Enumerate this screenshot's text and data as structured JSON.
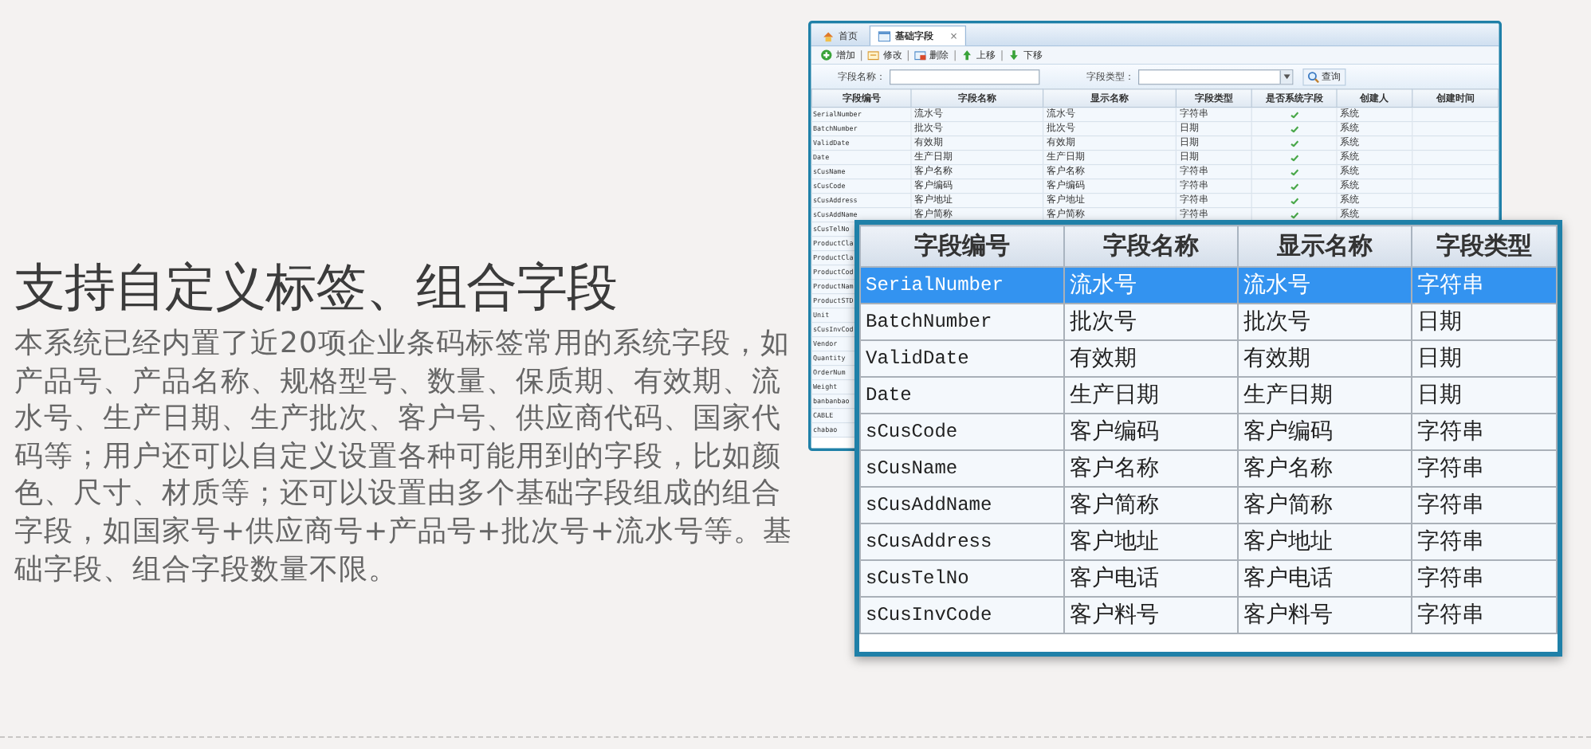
{
  "headline": "支持自定义标签、组合字段",
  "description": "本系统已经内置了近20项企业条码标签常用的系统字段，如产品号、产品名称、规格型号、数量、保质期、有效期、流水号、生产日期、生产批次、客户号、供应商代码、国家代码等；用户还可以自定义设置各种可能用到的字段，比如颜色、尺寸、材质等；还可以设置由多个基础字段组成的组合字段，如国家号+供应商号+产品号+批次号+流水号等。基础字段、组合字段数量不限。",
  "back_window": {
    "tabs": [
      {
        "label": "首页",
        "kind": "home",
        "selected": false
      },
      {
        "label": "基础字段",
        "kind": "page",
        "selected": true,
        "close": "×"
      }
    ],
    "toolbar": [
      {
        "label": "增加",
        "kind": "add"
      },
      {
        "label": "修改",
        "kind": "edit"
      },
      {
        "label": "删除",
        "kind": "delete"
      },
      {
        "label": "上移",
        "kind": "up"
      },
      {
        "label": "下移",
        "kind": "down"
      }
    ],
    "search": {
      "name_label": "字段名称：",
      "type_label": "字段类型：",
      "button": "查询"
    },
    "table": {
      "columns": [
        "字段编号",
        "字段名称",
        "显示名称",
        "字段类型",
        "是否系统字段",
        "创建人",
        "创建时间"
      ],
      "rows": [
        {
          "cells": [
            "SerialNumber",
            "流水号",
            "流水号",
            "字符串",
            "",
            "系统",
            ""
          ],
          "system": true
        },
        {
          "cells": [
            "BatchNumber",
            "批次号",
            "批次号",
            "日期",
            "",
            "系统",
            ""
          ],
          "system": true
        },
        {
          "cells": [
            "ValidDate",
            "有效期",
            "有效期",
            "日期",
            "",
            "系统",
            ""
          ],
          "system": true
        },
        {
          "cells": [
            "Date",
            "生产日期",
            "生产日期",
            "日期",
            "",
            "系统",
            ""
          ],
          "system": true
        },
        {
          "cells": [
            "sCusName",
            "客户名称",
            "客户名称",
            "字符串",
            "",
            "系统",
            ""
          ],
          "system": true
        },
        {
          "cells": [
            "sCusCode",
            "客户编码",
            "客户编码",
            "字符串",
            "",
            "系统",
            ""
          ],
          "system": true
        },
        {
          "cells": [
            "sCusAddress",
            "客户地址",
            "客户地址",
            "字符串",
            "",
            "系统",
            ""
          ],
          "system": true
        },
        {
          "cells": [
            "sCusAddName",
            "客户简称",
            "客户简称",
            "字符串",
            "",
            "系统",
            ""
          ],
          "system": true
        },
        {
          "cells": [
            "sCusTelNo"
          ]
        },
        {
          "cells": [
            "ProductCla"
          ]
        },
        {
          "cells": [
            "ProductCla"
          ]
        },
        {
          "cells": [
            "ProductCod"
          ]
        },
        {
          "cells": [
            "ProductNam"
          ]
        },
        {
          "cells": [
            "ProductSTD"
          ]
        },
        {
          "cells": [
            "Unit"
          ]
        },
        {
          "cells": [
            "sCusInvCod"
          ]
        },
        {
          "cells": [
            "Vendor"
          ]
        },
        {
          "cells": [
            "Quantity"
          ]
        },
        {
          "cells": [
            "OrderNum"
          ]
        },
        {
          "cells": [
            "Weight"
          ]
        },
        {
          "cells": [
            "banbanbao"
          ]
        },
        {
          "cells": [
            "CABLE"
          ]
        },
        {
          "cells": [
            "chabao"
          ]
        }
      ]
    }
  },
  "front_table": {
    "columns": [
      "字段编号",
      "字段名称",
      "显示名称",
      "字段类型"
    ],
    "rows": [
      {
        "cells": [
          "SerialNumber",
          "流水号",
          "流水号",
          "字符串"
        ],
        "selected": true
      },
      {
        "cells": [
          "BatchNumber",
          "批次号",
          "批次号",
          "日期"
        ],
        "selected": false
      },
      {
        "cells": [
          "ValidDate",
          "有效期",
          "有效期",
          "日期"
        ],
        "selected": false
      },
      {
        "cells": [
          "Date",
          "生产日期",
          "生产日期",
          "日期"
        ],
        "selected": false
      },
      {
        "cells": [
          "sCusCode",
          "客户编码",
          "客户编码",
          "字符串"
        ],
        "selected": false
      },
      {
        "cells": [
          "sCusName",
          "客户名称",
          "客户名称",
          "字符串"
        ],
        "selected": false
      },
      {
        "cells": [
          "sCusAddName",
          "客户简称",
          "客户简称",
          "字符串"
        ],
        "selected": false
      },
      {
        "cells": [
          "sCusAddress",
          "客户地址",
          "客户地址",
          "字符串"
        ],
        "selected": false
      },
      {
        "cells": [
          "sCusTelNo",
          "客户电话",
          "客户电话",
          "字符串"
        ],
        "selected": false
      },
      {
        "cells": [
          "sCusInvCode",
          "客户料号",
          "客户料号",
          "字符串"
        ],
        "selected": false
      }
    ]
  }
}
